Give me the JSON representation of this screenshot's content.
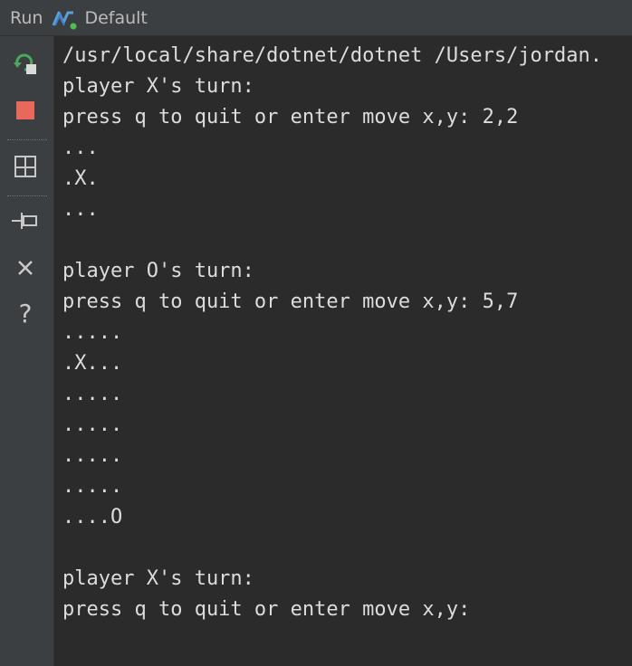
{
  "toolbar": {
    "run_label": "Run",
    "config_name": "Default",
    "config_icon": "dotnet-icon"
  },
  "sidebar": {
    "tools": [
      {
        "name": "rerun-icon"
      },
      {
        "name": "stop-icon"
      },
      {
        "name": "layout-icon"
      },
      {
        "name": "pin-icon"
      },
      {
        "name": "close-icon"
      },
      {
        "name": "help-icon",
        "glyph": "?"
      }
    ]
  },
  "console": {
    "lines": [
      "/usr/local/share/dotnet/dotnet /Users/jordan.",
      "player X's turn:",
      "press q to quit or enter move x,y: 2,2",
      "...",
      ".X.",
      "...",
      "",
      "player O's turn:",
      "press q to quit or enter move x,y: 5,7",
      ".....",
      ".X...",
      ".....",
      ".....",
      ".....",
      ".....",
      "....O",
      "",
      "player X's turn:",
      "press q to quit or enter move x,y:"
    ]
  },
  "colors": {
    "background": "#2b2b2b",
    "panel": "#3c3f41",
    "text": "#dcdcdc",
    "stop": "#e8695c",
    "rerun_green": "#4aa85c"
  }
}
